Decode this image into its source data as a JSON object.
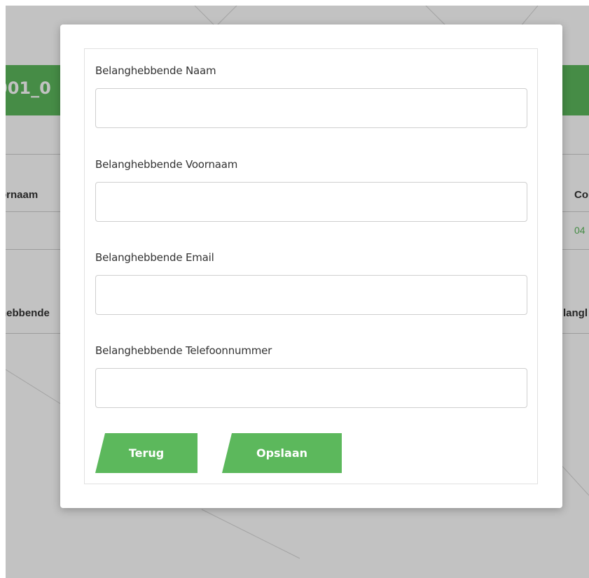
{
  "background": {
    "banner_title": "001_0",
    "col_left_header": "ornaam",
    "col_right_header": "Co",
    "col_right_value": "04",
    "row2_left_header": "hebbende",
    "row2_right_header": "langl",
    "accent_color": "#5cb85c"
  },
  "form": {
    "fields": [
      {
        "label": "Belanghebbende Naam",
        "value": ""
      },
      {
        "label": "Belanghebbende Voornaam",
        "value": ""
      },
      {
        "label": "Belanghebbende Email",
        "value": ""
      },
      {
        "label": "Belanghebbende Telefoonnummer",
        "value": ""
      }
    ],
    "back_label": "Terug",
    "save_label": "Opslaan"
  }
}
